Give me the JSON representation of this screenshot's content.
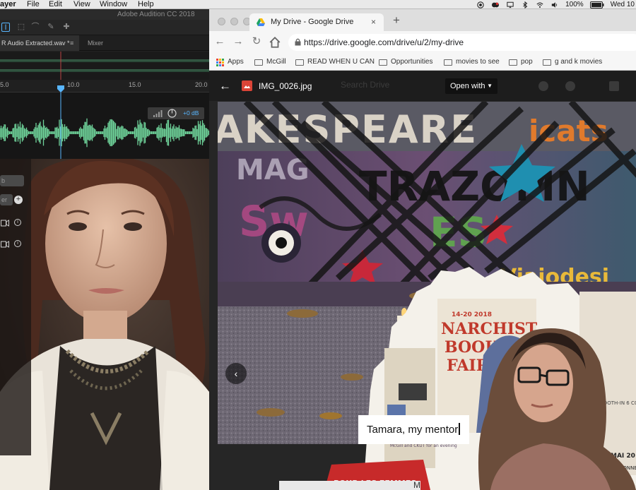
{
  "menubar": {
    "app": "ayer",
    "items": [
      "File",
      "Edit",
      "View",
      "Window",
      "Help"
    ],
    "battery": "100%",
    "clock": "Wed 10"
  },
  "audition": {
    "window_title": "Adobe Audition CC 2018",
    "file_tab": "R Audio Extracted.wav *",
    "mixer_tab": "Mixer",
    "ruler_ticks": [
      "5.0",
      "10.0",
      "15.0",
      "20.0"
    ],
    "level_readout": "+0 dB",
    "waveform_color": "#6fd39a"
  },
  "sidebar": {
    "field1": "b",
    "field2": "er"
  },
  "chrome": {
    "tab_title": "My Drive - Google Drive",
    "url": "https://drive.google.com/drive/u/2/my-drive",
    "bookmarks": [
      "Apps",
      "McGill",
      "READ WHEN U CAN",
      "Opportunities",
      "movies to see",
      "pop",
      "g and k movies"
    ]
  },
  "viewer": {
    "file_name": "IMG_0026.jpg",
    "search_placeholder": "Search Drive",
    "open_with": "Open with"
  },
  "overlay": {
    "caption": "Tamara, my mentor",
    "drive_peek": "My Drive"
  },
  "colors": {
    "drive_red": "#db4437",
    "waveform": "#6fd39a",
    "audition_blue": "#58b6ff"
  }
}
